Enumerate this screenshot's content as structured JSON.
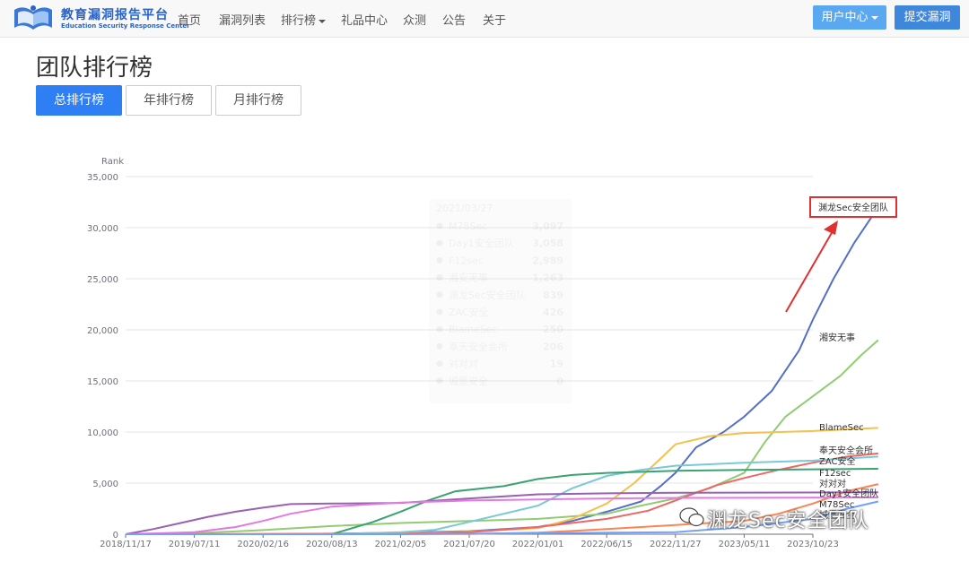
{
  "nav": {
    "brand_title": "教育漏洞报告平台",
    "brand_sub": "Education Security Response Center",
    "items": [
      {
        "label": "首页"
      },
      {
        "label": "漏洞列表"
      },
      {
        "label": "排行榜"
      },
      {
        "label": "礼品中心"
      },
      {
        "label": "众测"
      },
      {
        "label": "公告"
      },
      {
        "label": "关于"
      }
    ],
    "user_center": "用户中心",
    "submit": "提交漏洞"
  },
  "page": {
    "title": "团队排行榜",
    "tabs": [
      {
        "label": "总排行榜",
        "active": true
      },
      {
        "label": "年排行榜",
        "active": false
      },
      {
        "label": "月排行榜",
        "active": false
      }
    ]
  },
  "annotation": {
    "label": "渊龙Sec安全团队",
    "color": "#e03030"
  },
  "tooltip": {
    "date": "2021/03/27",
    "rows": [
      {
        "name": "M78Sec",
        "value": "3,097"
      },
      {
        "name": "Day1安全团队",
        "value": "3,058"
      },
      {
        "name": "F12sec",
        "value": "2,989"
      },
      {
        "name": "湘安无事",
        "value": "1,263"
      },
      {
        "name": "渊龙Sec安全团队",
        "value": "839"
      },
      {
        "name": "ZAC安全",
        "value": "426"
      },
      {
        "name": "BlameSec",
        "value": "250"
      },
      {
        "name": "奉天安全会所",
        "value": "206"
      },
      {
        "name": "对对对",
        "value": "19"
      },
      {
        "name": "城堡安全",
        "value": "0"
      }
    ]
  },
  "watermark": "渊龙Sec安全团队",
  "chart_data": {
    "type": "line",
    "ylabel": "Rank",
    "ylim": [
      0,
      35000
    ],
    "yticks": [
      "0",
      "5,000",
      "10,000",
      "15,000",
      "20,000",
      "25,000",
      "30,000",
      "35,000"
    ],
    "xticks": [
      "2018/11/17",
      "2019/07/11",
      "2020/02/16",
      "2020/08/13",
      "2021/02/05",
      "2021/07/20",
      "2022/01/01",
      "2022/06/15",
      "2022/11/27",
      "2023/05/11",
      "2023/10/23"
    ],
    "grid": true,
    "series": [
      {
        "name": "渊龙Sec安全团队",
        "color": "#5470c6",
        "points": [
          [
            0,
            0
          ],
          [
            2,
            0
          ],
          [
            3,
            50
          ],
          [
            4,
            150
          ],
          [
            5,
            300
          ],
          [
            6,
            700
          ],
          [
            6.5,
            1300
          ],
          [
            7,
            2200
          ],
          [
            7.5,
            3200
          ],
          [
            7.8,
            4800
          ],
          [
            8,
            6000
          ],
          [
            8.3,
            8500
          ],
          [
            8.7,
            10000
          ],
          [
            9,
            11500
          ],
          [
            9.4,
            14000
          ],
          [
            9.8,
            18000
          ],
          [
            10,
            21000
          ],
          [
            10.3,
            25000
          ],
          [
            10.6,
            28500
          ],
          [
            10.8,
            30500
          ],
          [
            10.95,
            32000
          ]
        ]
      },
      {
        "name": "湘安无事",
        "color": "#91cc75",
        "points": [
          [
            0,
            0
          ],
          [
            1,
            100
          ],
          [
            2,
            400
          ],
          [
            3,
            800
          ],
          [
            4,
            1100
          ],
          [
            5,
            1300
          ],
          [
            6,
            1500
          ],
          [
            7,
            2000
          ],
          [
            7.5,
            2800
          ],
          [
            8,
            3500
          ],
          [
            8.5,
            4500
          ],
          [
            9,
            6000
          ],
          [
            9.3,
            9000
          ],
          [
            9.6,
            11500
          ],
          [
            10,
            13500
          ],
          [
            10.4,
            15500
          ],
          [
            10.7,
            17500
          ],
          [
            10.95,
            19000
          ]
        ]
      },
      {
        "name": "BlameSec",
        "color": "#f2c14e",
        "points": [
          [
            0,
            0
          ],
          [
            3,
            0
          ],
          [
            4,
            100
          ],
          [
            5,
            250
          ],
          [
            6,
            600
          ],
          [
            6.5,
            1500
          ],
          [
            7,
            3000
          ],
          [
            7.4,
            5000
          ],
          [
            7.8,
            7500
          ],
          [
            8,
            8800
          ],
          [
            8.5,
            9600
          ],
          [
            9,
            9900
          ],
          [
            10,
            10100
          ],
          [
            10.95,
            10400
          ]
        ]
      },
      {
        "name": "奉天安全会所",
        "color": "#ee6666",
        "points": [
          [
            0,
            0
          ],
          [
            4,
            50
          ],
          [
            5,
            206
          ],
          [
            6,
            700
          ],
          [
            7,
            1500
          ],
          [
            7.6,
            2300
          ],
          [
            8,
            3300
          ],
          [
            8.6,
            4800
          ],
          [
            9,
            5500
          ],
          [
            9.5,
            6300
          ],
          [
            10,
            7000
          ],
          [
            10.5,
            7600
          ],
          [
            10.95,
            7900
          ]
        ]
      },
      {
        "name": "ZAC安全",
        "color": "#7bc8d8",
        "points": [
          [
            0,
            0
          ],
          [
            3,
            0
          ],
          [
            4,
            200
          ],
          [
            4.5,
            426
          ],
          [
            5,
            1200
          ],
          [
            6,
            2800
          ],
          [
            6.5,
            4500
          ],
          [
            7,
            5700
          ],
          [
            7.5,
            6300
          ],
          [
            8,
            6700
          ],
          [
            9,
            7000
          ],
          [
            10,
            7200
          ],
          [
            10.95,
            7600
          ]
        ]
      },
      {
        "name": "F12sec",
        "color": "#3ba272",
        "points": [
          [
            0,
            0
          ],
          [
            3,
            0
          ],
          [
            3.6,
            1200
          ],
          [
            4,
            2200
          ],
          [
            4.4,
            3300
          ],
          [
            4.8,
            4200
          ],
          [
            5.5,
            4700
          ],
          [
            6,
            5400
          ],
          [
            6.5,
            5800
          ],
          [
            7,
            6000
          ],
          [
            8,
            6200
          ],
          [
            9,
            6300
          ],
          [
            10.95,
            6400
          ]
        ]
      },
      {
        "name": "对对对",
        "color": "#fc8452",
        "points": [
          [
            0,
            0
          ],
          [
            5,
            19
          ],
          [
            6,
            150
          ],
          [
            7,
            500
          ],
          [
            8,
            900
          ],
          [
            9,
            1300
          ],
          [
            9.5,
            2000
          ],
          [
            10,
            3000
          ],
          [
            10.5,
            4200
          ],
          [
            10.95,
            4900
          ]
        ]
      },
      {
        "name": "Day1安全团队",
        "color": "#9a60b4",
        "points": [
          [
            0,
            0
          ],
          [
            0.4,
            500
          ],
          [
            0.8,
            1100
          ],
          [
            1.2,
            1700
          ],
          [
            1.6,
            2200
          ],
          [
            2,
            2600
          ],
          [
            2.4,
            2950
          ],
          [
            3,
            3000
          ],
          [
            4,
            3058
          ],
          [
            5,
            3500
          ],
          [
            6,
            3900
          ],
          [
            7,
            4000
          ],
          [
            8,
            4050
          ],
          [
            10.95,
            4100
          ]
        ]
      },
      {
        "name": "M78Sec",
        "color": "#e07be0",
        "points": [
          [
            0,
            0
          ],
          [
            1,
            200
          ],
          [
            1.6,
            700
          ],
          [
            2,
            1300
          ],
          [
            2.4,
            2000
          ],
          [
            3,
            2700
          ],
          [
            4,
            3097
          ],
          [
            5,
            3300
          ],
          [
            6,
            3400
          ],
          [
            7,
            3500
          ],
          [
            8,
            3550
          ],
          [
            10.95,
            3600
          ]
        ]
      },
      {
        "name": "城堡安全",
        "color": "#73a0fa",
        "points": [
          [
            0,
            0
          ],
          [
            4,
            0
          ],
          [
            6,
            100
          ],
          [
            8,
            200
          ],
          [
            9,
            700
          ],
          [
            10,
            1500
          ],
          [
            10.5,
            2500
          ],
          [
            10.95,
            3200
          ]
        ]
      }
    ]
  }
}
